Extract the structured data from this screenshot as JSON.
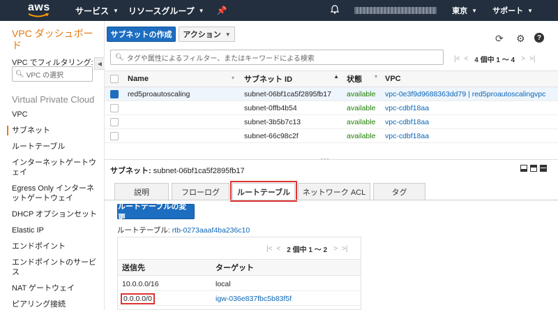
{
  "nav": {
    "logo": "aws",
    "services": "サービス",
    "resource_groups": "リソースグループ",
    "region": "東京",
    "support": "サポート"
  },
  "sidebar": {
    "title": "VPC ダッシュボード",
    "filter_label": "VPC でフィルタリング:",
    "vpc_select": "VPC の選択",
    "section": "Virtual Private Cloud",
    "items": [
      "VPC",
      "サブネット",
      "ルートテーブル",
      "インターネットゲートウェイ",
      "Egress Only インターネットゲートウェイ",
      "DHCP オプションセット",
      "Elastic IP",
      "エンドポイント",
      "エンドポイントのサービス",
      "NAT ゲートウェイ",
      "ピアリング接続"
    ],
    "active_index": 1
  },
  "toolbar": {
    "create_subnet": "サブネットの作成",
    "actions": "アクション"
  },
  "search": {
    "placeholder": "タグや属性によるフィルター、またはキーワードによる検索",
    "pager": "4 個中 1 ～ 4"
  },
  "table": {
    "headers": {
      "name": "Name",
      "subnet_id": "サブネット ID",
      "state": "状態",
      "vpc": "VPC"
    },
    "rows": [
      {
        "name": "red5proautoscaling",
        "subnet_id": "subnet-06bf1ca5f2895fb17",
        "state": "available",
        "vpc": "vpc-0e3f9d9688363dd79 | red5proautoscalingvpc",
        "selected": true
      },
      {
        "name": "",
        "subnet_id": "subnet-0ffb4b54",
        "state": "available",
        "vpc": "vpc-cdbf18aa",
        "selected": false
      },
      {
        "name": "",
        "subnet_id": "subnet-3b5b7c13",
        "state": "available",
        "vpc": "vpc-cdbf18aa",
        "selected": false
      },
      {
        "name": "",
        "subnet_id": "subnet-66c98c2f",
        "state": "available",
        "vpc": "vpc-cdbf18aa",
        "selected": false
      }
    ]
  },
  "detail": {
    "label": "サブネット:",
    "subnet": "subnet-06bf1ca5f2895fb17",
    "tabs": [
      "説明",
      "フローログ",
      "ルートテーブル",
      "ネットワーク ACL",
      "タグ"
    ],
    "active_tab": 2,
    "change_rt_button": "ルートテーブルの変更",
    "rt_label": "ルートテーブル:",
    "rt_id": "rtb-0273aaaf4ba236c10",
    "pager": "2 個中 1 ～ 2",
    "routes_headers": {
      "destination": "送信先",
      "target": "ターゲット"
    },
    "routes": [
      {
        "destination": "10.0.0.0/16",
        "target": "local"
      },
      {
        "destination": "0.0.0.0/0",
        "target": "igw-036e837fbc5b83f5f"
      }
    ]
  },
  "colors": {
    "nav_bg": "#232f3e",
    "accent_orange": "#e47911",
    "primary_blue": "#1d6dc0",
    "available_green": "#1d8102",
    "highlight_red": "#dd3333"
  }
}
